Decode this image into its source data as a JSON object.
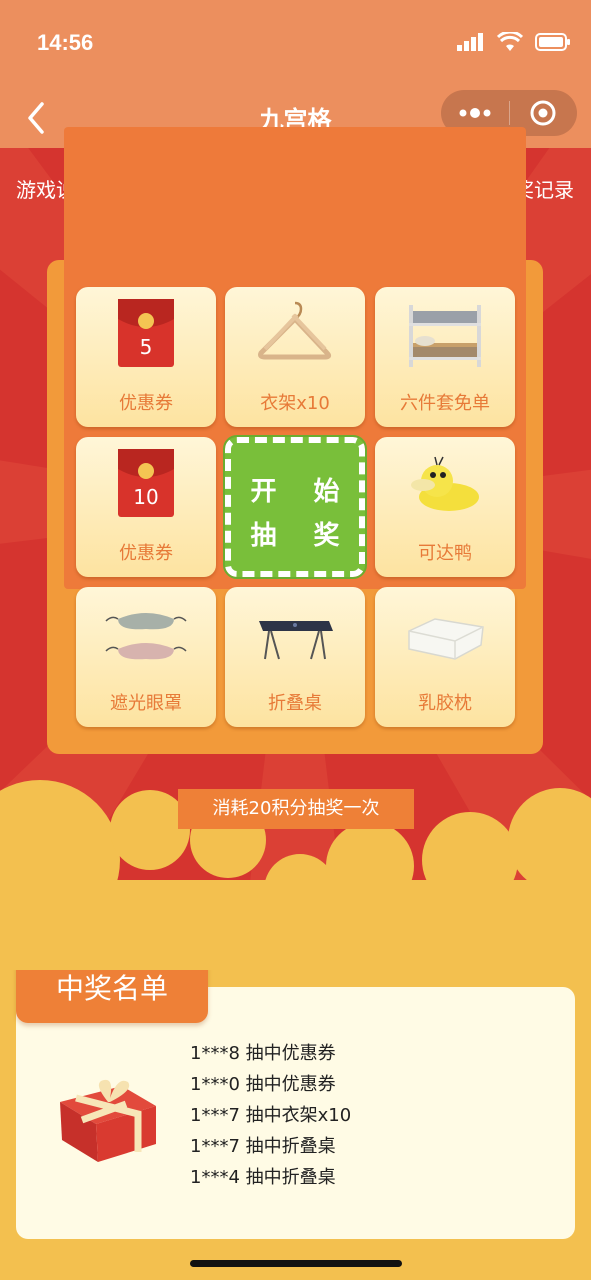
{
  "status_bar": {
    "time": "14:56"
  },
  "nav": {
    "title": "九宫格"
  },
  "links": {
    "rules": "游戏说明",
    "records": "中奖记录"
  },
  "grid": {
    "cells": [
      {
        "label": "优惠券",
        "icon": "red-envelope-icon",
        "badge": "5"
      },
      {
        "label": "衣架x10",
        "icon": "hanger-icon"
      },
      {
        "label": "六件套免单",
        "icon": "bunk-bed-icon"
      },
      {
        "label": "优惠券",
        "icon": "red-envelope-icon",
        "badge": "10"
      },
      {
        "label": "可达鸭",
        "icon": "duck-plush-icon"
      },
      {
        "label": "遮光眼罩",
        "icon": "eye-mask-icon"
      },
      {
        "label": "折叠桌",
        "icon": "folding-table-icon"
      },
      {
        "label": "乳胶枕",
        "icon": "latex-pillow-icon"
      }
    ],
    "start_line1": "开 始",
    "start_line2": "抽 奖"
  },
  "cost_text": "消耗20积分抽奖一次",
  "winners": {
    "title": "中奖名单",
    "items": [
      "1***8 抽中优惠券",
      "1***0 抽中优惠券",
      "1***7 抽中衣架x10",
      "1***7 抽中折叠桌",
      "1***4 抽中折叠桌"
    ]
  },
  "colors": {
    "header": "#ec8f5e",
    "background_red": "#d5342f",
    "board_orange": "#f29a3a",
    "start_green": "#79bf3a",
    "label_orange": "#e77a38",
    "cloud_yellow": "#f3c04f"
  }
}
